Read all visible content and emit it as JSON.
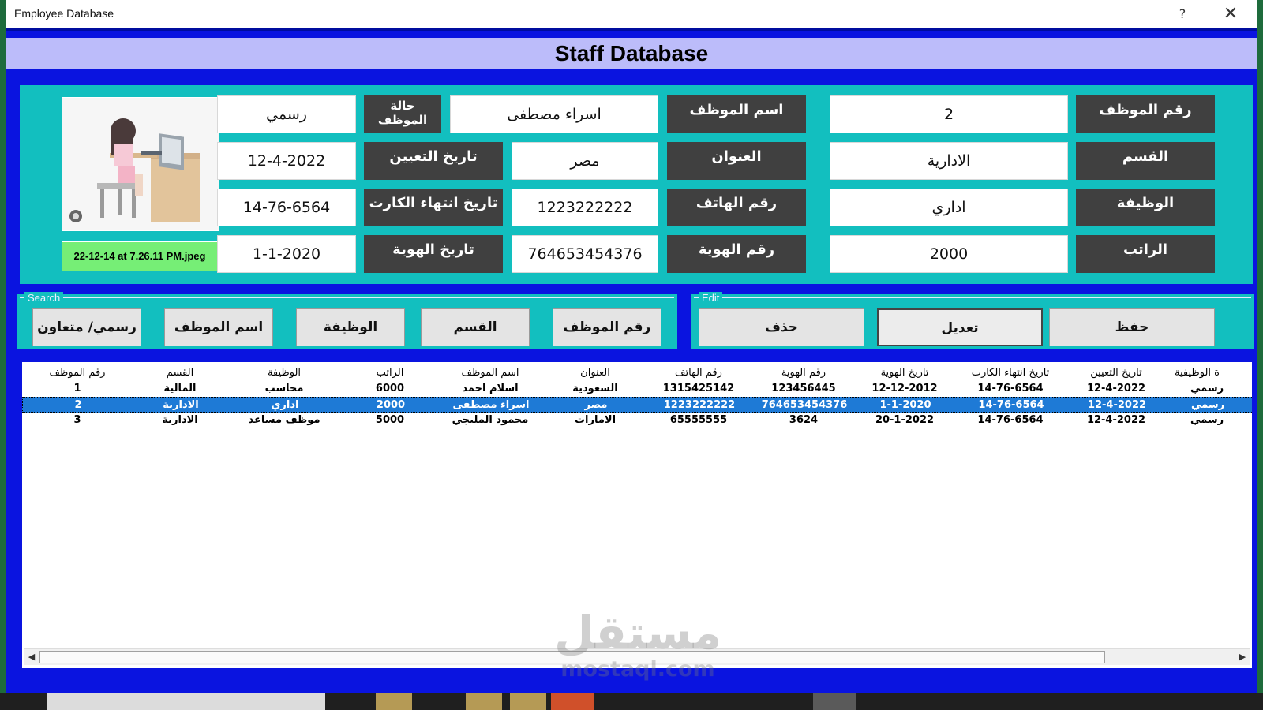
{
  "window": {
    "title": "Employee Database",
    "help": "?",
    "close": "✕"
  },
  "heading": "Staff Database",
  "photo": {
    "filename": "22-12-14 at 7.26.11 PM.jpeg"
  },
  "form": {
    "emp_id": {
      "label": "رقم الموظف",
      "value": "2"
    },
    "department": {
      "label": "القسم",
      "value": "الادارية"
    },
    "job": {
      "label": "الوظيفة",
      "value": "اداري"
    },
    "salary": {
      "label": "الراتب",
      "value": "2000"
    },
    "emp_name": {
      "label": "اسم الموظف",
      "value": "اسراء مصطفى"
    },
    "address": {
      "label": "العنوان",
      "value": "مصر"
    },
    "phone": {
      "label": "رقم الهاتف",
      "value": "1223222222"
    },
    "id_number": {
      "label": "رقم الهوية",
      "value": "764653454376"
    },
    "emp_status": {
      "label": "حالة الموظف",
      "value": "رسمي"
    },
    "hire_date": {
      "label": "تاريخ التعيين",
      "value": "12-4-2022"
    },
    "card_expiry": {
      "label": "تاريخ انتهاء الكارت",
      "value": "14-76-6564"
    },
    "id_date": {
      "label": "تاريخ الهوية",
      "value": "1-1-2020"
    }
  },
  "search": {
    "legend": "Search",
    "buttons": [
      "رسمي/ متعاون",
      "اسم الموظف",
      "الوظيفة",
      "القسم",
      "رقم الموظف"
    ]
  },
  "edit": {
    "legend": "Edit",
    "buttons": [
      "حذف",
      "تعديل",
      "حفظ"
    ]
  },
  "table": {
    "columns": [
      "رقم الموظف",
      "القسم",
      "الوظيفة",
      "الراتب",
      "اسم الموظف",
      "العنوان",
      "رقم الهاتف",
      "رقم الهوية",
      "تاريخ الهوية",
      "تاريخ انتهاء الكارت",
      "تاريخ التعيين",
      "ة الوظيفية"
    ],
    "rows": [
      [
        "1",
        "المالية",
        "محاسب",
        "6000",
        "اسلام احمد",
        "السعودية",
        "1315425142",
        "123456445",
        "12-12-2012",
        "14-76-6564",
        "12-4-2022",
        "رسمي"
      ],
      [
        "2",
        "الادارية",
        "اداري",
        "2000",
        "اسراء مصطفى",
        "مصر",
        "1223222222",
        "764653454376",
        "1-1-2020",
        "14-76-6564",
        "12-4-2022",
        "رسمي"
      ],
      [
        "3",
        "الادارية",
        "موظف مساعد",
        "5000",
        "محمود المليجي",
        "الامارات",
        "65555555",
        "3624",
        "20-1-2022",
        "14-76-6564",
        "12-4-2022",
        "رسمي"
      ]
    ],
    "selected_row": 1
  },
  "scrollbar": {
    "left": "◀",
    "right": "▶"
  },
  "watermark": {
    "line1": "مستقل",
    "line2": "mostaql.com"
  },
  "colors": {
    "window_blue": "#0a14e0",
    "panel_teal": "#12bfbf",
    "label_dark": "#404040",
    "heading_band": "#bcbcfa",
    "filename_green": "#76ee76",
    "selection_blue": "#1e7ad6"
  }
}
